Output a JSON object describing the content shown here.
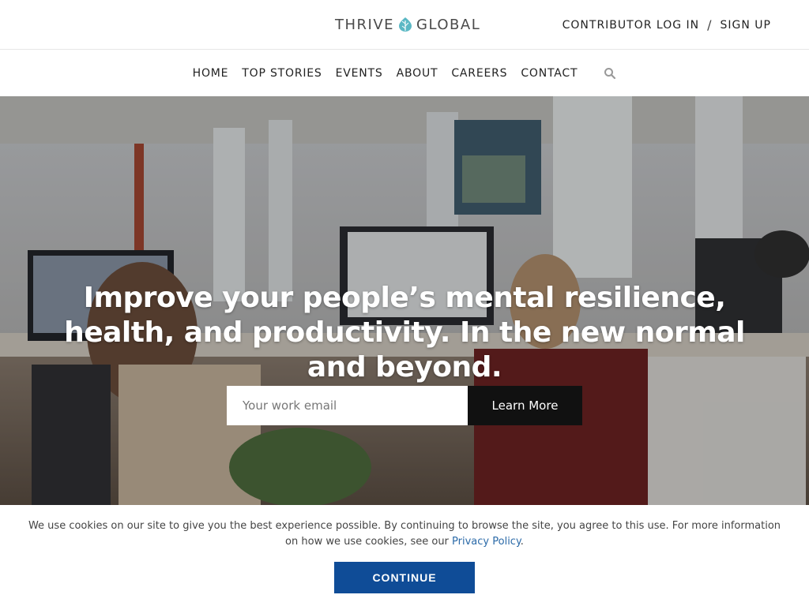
{
  "header": {
    "logo_left": "THRIVE",
    "logo_right": "GLOBAL",
    "contributor_login": "CONTRIBUTOR LOG IN",
    "separator": "/",
    "sign_up": "SIGN UP"
  },
  "nav": {
    "items": [
      {
        "label": "HOME"
      },
      {
        "label": "TOP STORIES"
      },
      {
        "label": "EVENTS"
      },
      {
        "label": "ABOUT"
      },
      {
        "label": "CAREERS"
      },
      {
        "label": "CONTACT"
      }
    ],
    "search_icon": "search-icon"
  },
  "hero": {
    "headline": "Improve your people’s mental resilience, health, and productivity. In the new normal and beyond.",
    "email_placeholder": "Your work email",
    "email_value": "",
    "button_label": "Learn More"
  },
  "cookie": {
    "text": "We use cookies on our site to give you the best experience possible. By continuing to browse the site, you agree to this use. For more information on how we use cookies, see our ",
    "link_label": "Privacy Policy",
    "text_end": ".",
    "button_label": "CONTINUE"
  },
  "colors": {
    "accent": "#0f4c97",
    "logo_mark": "#5bb8c4",
    "link": "#2b6aa8"
  }
}
